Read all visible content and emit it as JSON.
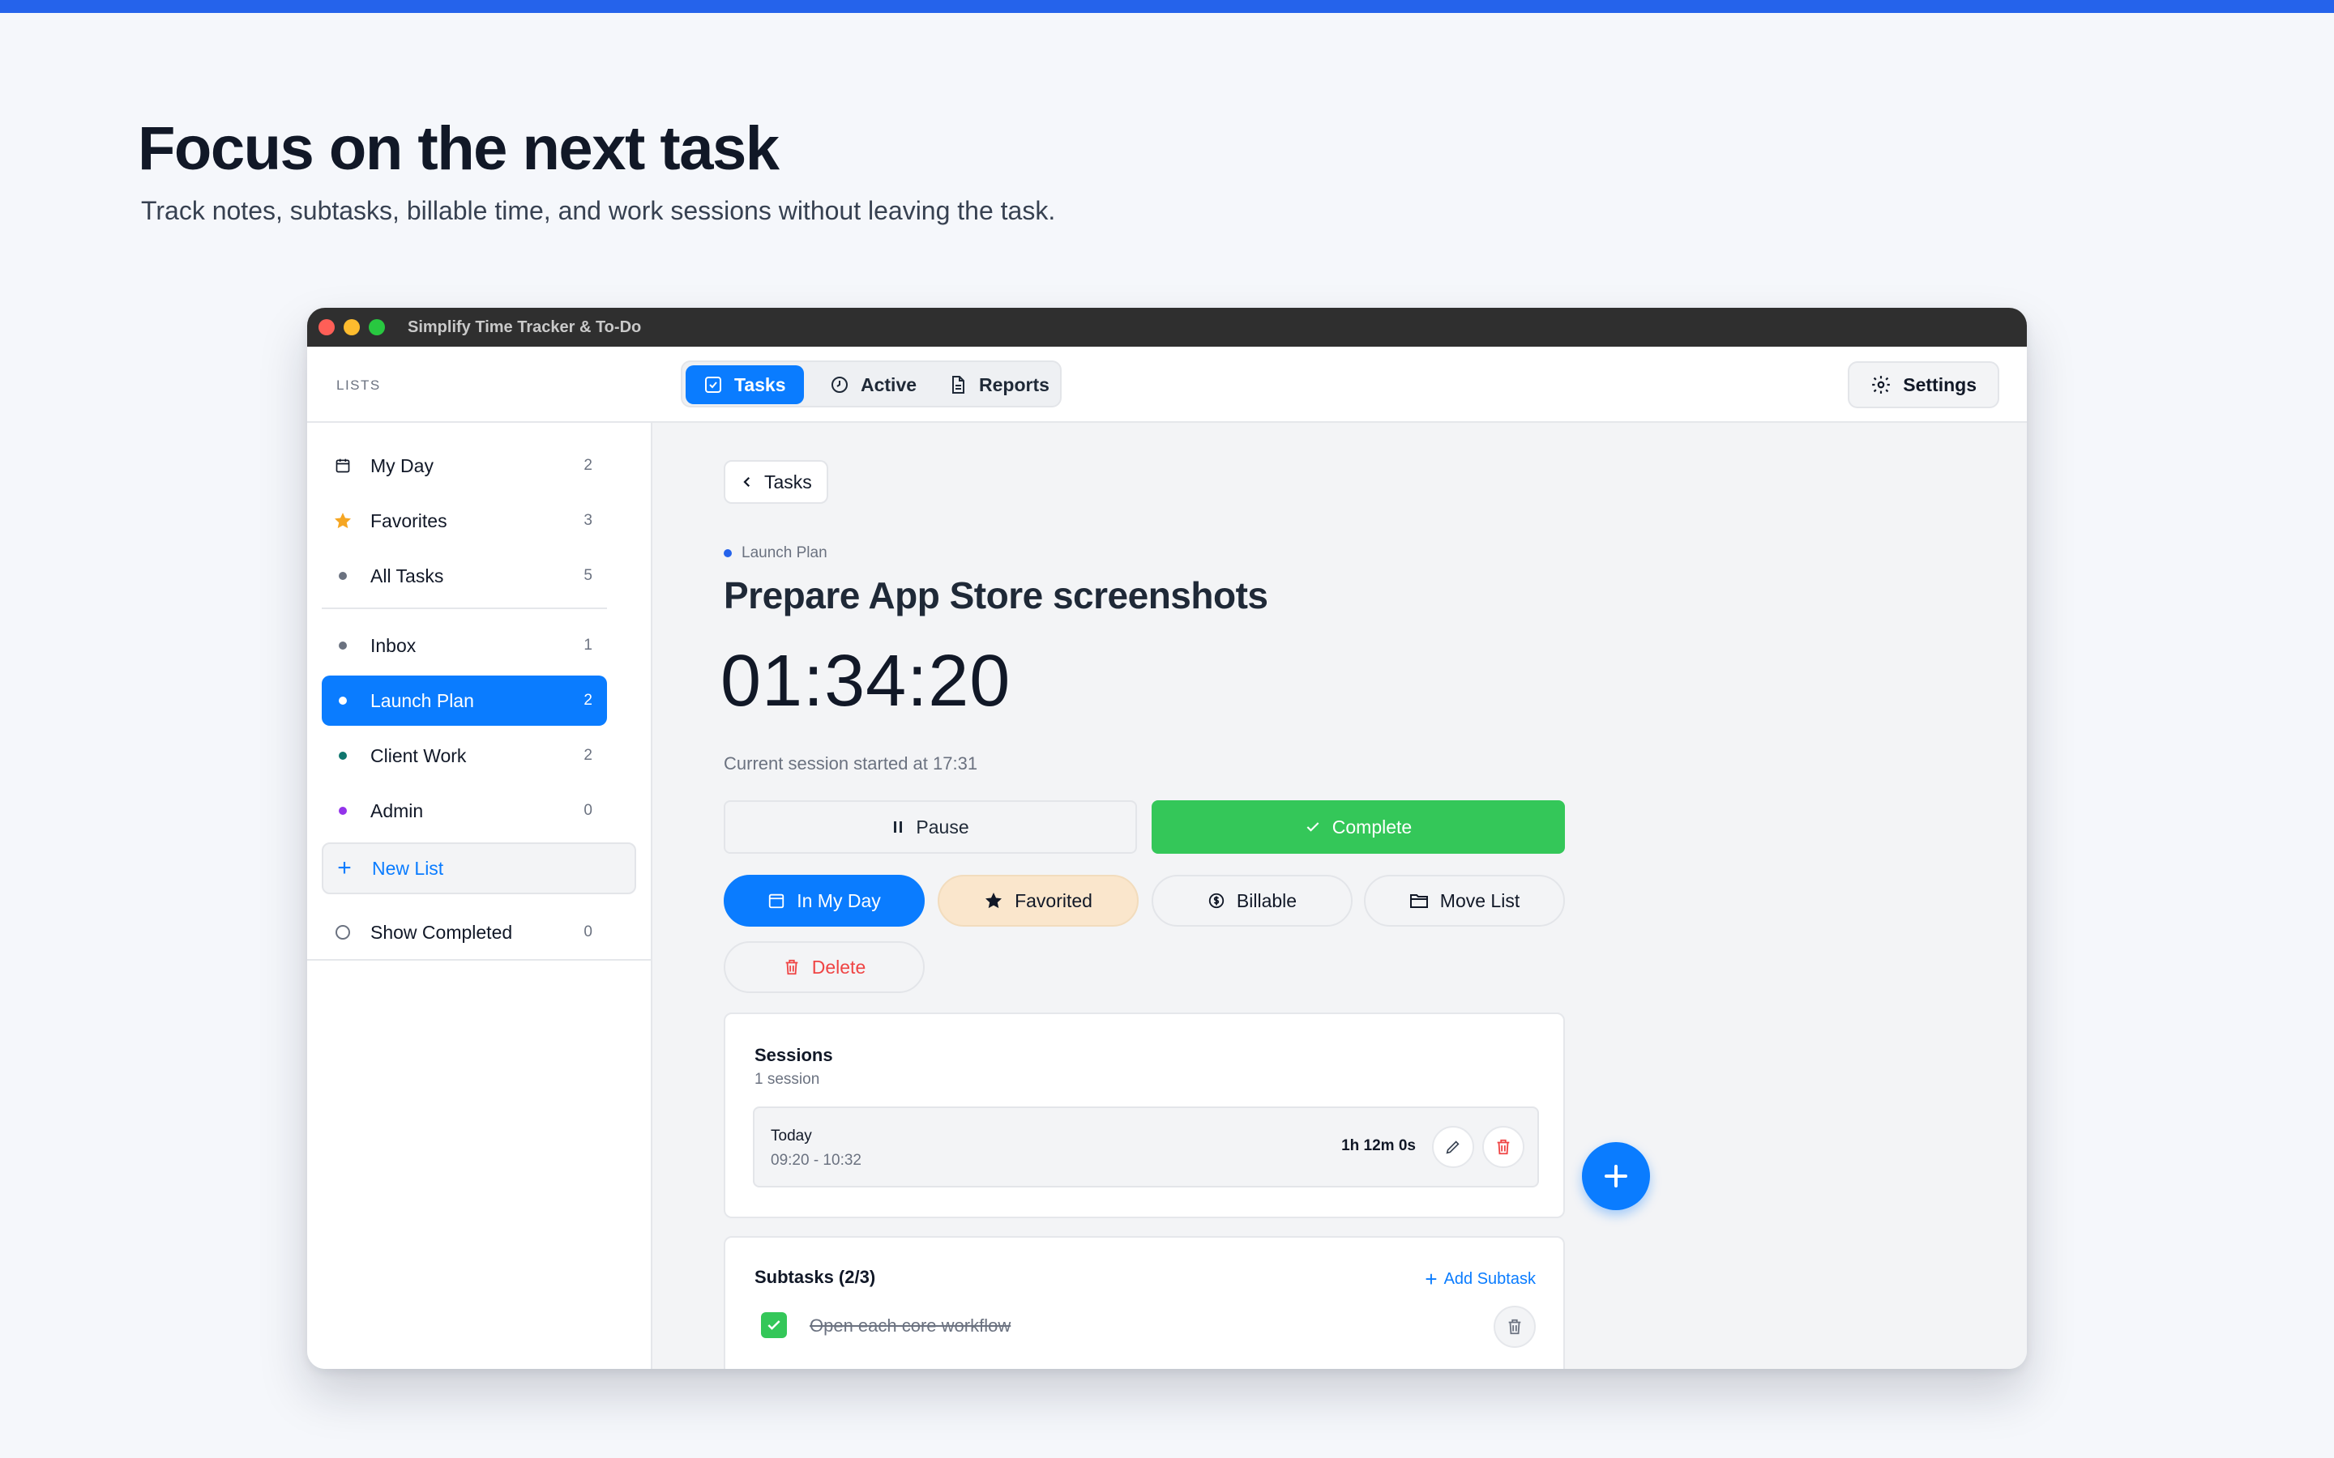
{
  "hero": {
    "title": "Focus on the next task",
    "subtitle": "Track notes, subtasks, billable time, and work sessions without leaving the task."
  },
  "window": {
    "title": "Simplify Time Tracker & To-Do"
  },
  "header": {
    "lists_label": "LISTS",
    "tabs": [
      {
        "label": "Tasks",
        "icon": "checkbox-icon",
        "active": true
      },
      {
        "label": "Active",
        "icon": "clock-icon",
        "active": false
      },
      {
        "label": "Reports",
        "icon": "document-icon",
        "active": false
      }
    ],
    "settings_label": "Settings"
  },
  "sidebar": {
    "smart_lists": [
      {
        "label": "My Day",
        "count": "2",
        "icon": "calendar-icon"
      },
      {
        "label": "Favorites",
        "count": "3",
        "icon": "star-icon"
      },
      {
        "label": "All Tasks",
        "count": "5",
        "icon": "dot-icon"
      }
    ],
    "lists": [
      {
        "label": "Inbox",
        "count": "1",
        "color": "#6b7280"
      },
      {
        "label": "Launch Plan",
        "count": "2",
        "color": "#ffffff",
        "active": true
      },
      {
        "label": "Client Work",
        "count": "2",
        "color": "#0f766e"
      },
      {
        "label": "Admin",
        "count": "0",
        "color": "#9333ea"
      }
    ],
    "new_list_label": "New List",
    "show_completed_label": "Show Completed",
    "show_completed_count": "0"
  },
  "task": {
    "back_label": "Tasks",
    "list_name": "Launch Plan",
    "list_color": "#2563eb",
    "title": "Prepare App Store screenshots",
    "timer": "01:34:20",
    "session_started": "Current session started at 17:31",
    "pause_label": "Pause",
    "complete_label": "Complete",
    "actions": {
      "in_my_day": "In My Day",
      "favorited": "Favorited",
      "billable": "Billable",
      "move_list": "Move List",
      "delete": "Delete"
    }
  },
  "sessions": {
    "title": "Sessions",
    "count_label": "1 session",
    "items": [
      {
        "day": "Today",
        "range": "09:20 - 10:32",
        "duration": "1h 12m 0s"
      }
    ]
  },
  "subtasks": {
    "title": "Subtasks (2/3)",
    "add_label": "Add Subtask",
    "items": [
      {
        "text": "Open each core workflow",
        "done": true
      }
    ]
  },
  "colors": {
    "accent": "#0a7cff",
    "success": "#34c759",
    "danger": "#ef4444",
    "favorite_bg": "#fae6cc",
    "brand_bar": "#2563eb"
  }
}
